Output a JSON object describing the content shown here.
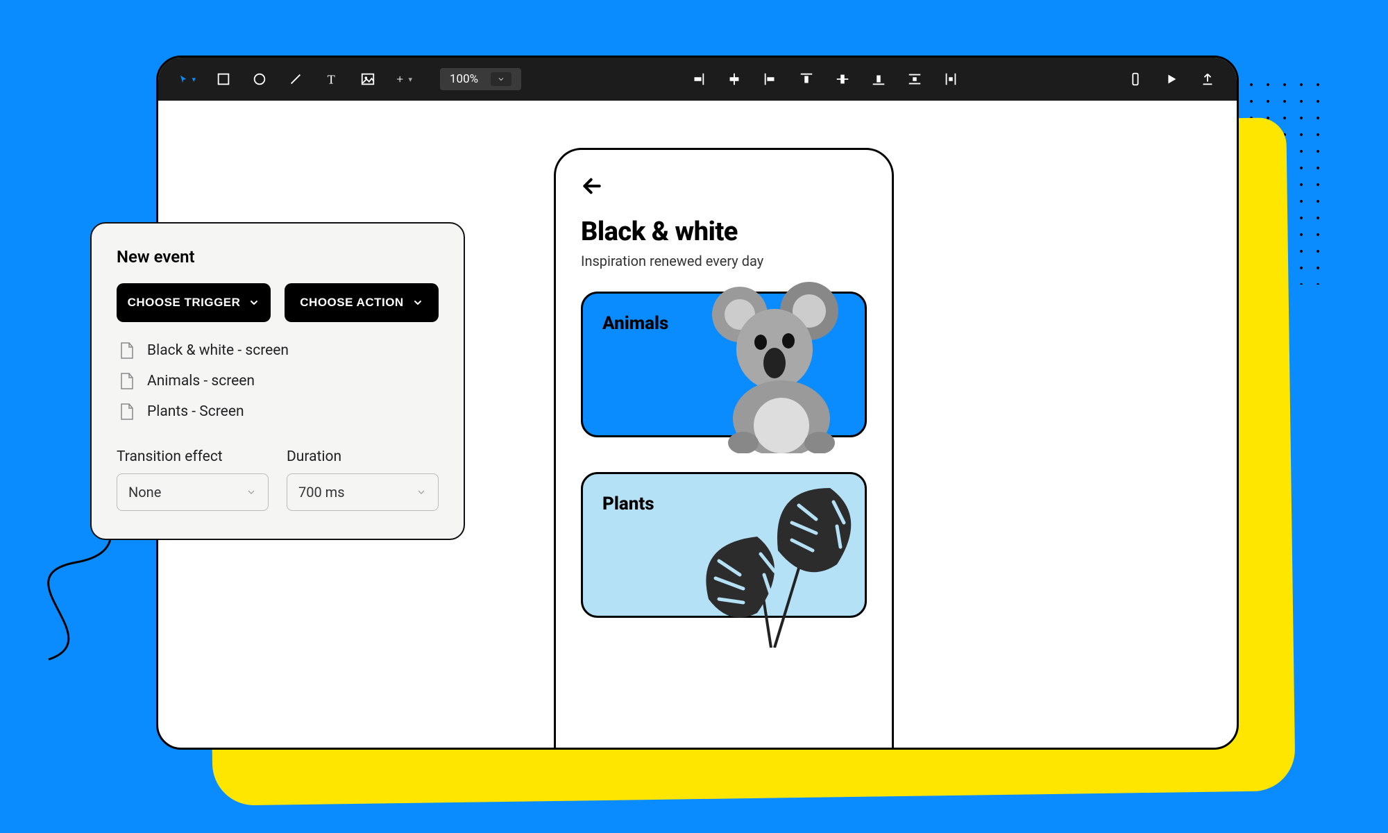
{
  "toolbar": {
    "zoom": "100%",
    "icons": {
      "cursor": "cursor-icon",
      "rect": "rectangle-icon",
      "circle": "circle-icon",
      "line": "line-icon",
      "text": "text-icon",
      "image": "image-icon",
      "add": "plus-icon",
      "align_right": "align-right-icon",
      "align_hcenter": "align-hcenter-icon",
      "align_left": "align-left-icon",
      "align_top": "align-top-icon",
      "align_vcenter": "align-vcenter-icon",
      "align_bottom": "align-bottom-icon",
      "dist_v": "distribute-vertical-icon",
      "dist_h": "distribute-horizontal-icon",
      "device": "device-icon",
      "play": "play-icon",
      "upload": "upload-icon"
    }
  },
  "panel": {
    "title": "New event",
    "trigger_btn": "CHOOSE TRIGGER",
    "action_btn": "CHOOSE ACTION",
    "screens": [
      "Black & white - screen",
      "Animals - screen",
      "Plants - Screen"
    ],
    "transition_label": "Transition effect",
    "transition_value": "None",
    "duration_label": "Duration",
    "duration_value": "700 ms"
  },
  "phone": {
    "title": "Black & white",
    "subtitle": "Inspiration renewed every day",
    "cards": [
      {
        "label": "Animals"
      },
      {
        "label": "Plants"
      }
    ]
  }
}
